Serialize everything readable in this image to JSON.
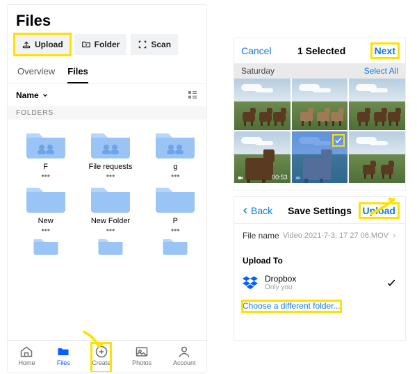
{
  "left_panel": {
    "title": "Files",
    "actions": {
      "upload": "Upload",
      "folder": "Folder",
      "scan": "Scan"
    },
    "tabs": {
      "overview": "Overview",
      "files": "Files"
    },
    "sort_label": "Name",
    "section_label": "FOLDERS",
    "folders": [
      {
        "name": "F",
        "shared": true
      },
      {
        "name": "File requests",
        "shared": true
      },
      {
        "name": "g",
        "shared": true
      },
      {
        "name": "New",
        "shared": false
      },
      {
        "name": "New Folder",
        "shared": false
      },
      {
        "name": "P",
        "shared": false
      }
    ],
    "nav": {
      "home": "Home",
      "files": "Files",
      "create": "Create",
      "photos": "Photos",
      "account": "Account"
    }
  },
  "picker": {
    "cancel": "Cancel",
    "title": "1 Selected",
    "next": "Next",
    "subheader": "Saturday",
    "select_all": "Select All",
    "thumbs": [
      {
        "video": false,
        "selected": false,
        "duration": ""
      },
      {
        "video": false,
        "selected": false,
        "duration": ""
      },
      {
        "video": false,
        "selected": false,
        "duration": ""
      },
      {
        "video": true,
        "selected": false,
        "duration": "00:53"
      },
      {
        "video": true,
        "selected": true,
        "duration": ""
      },
      {
        "video": false,
        "selected": false,
        "duration": ""
      }
    ]
  },
  "save": {
    "back": "Back",
    "title": "Save Settings",
    "upload": "Upload",
    "file_name_label": "File name",
    "file_name_value": "Video 2021-7-3, 17 27 06.MOV",
    "upload_to_label": "Upload To",
    "dest_name": "Dropbox",
    "dest_sub": "Only you",
    "choose_folder": "Choose a different folder..."
  },
  "colors": {
    "accent": "#1079e8",
    "folder": "#9ac4f5",
    "highlight": "#ffe100"
  }
}
